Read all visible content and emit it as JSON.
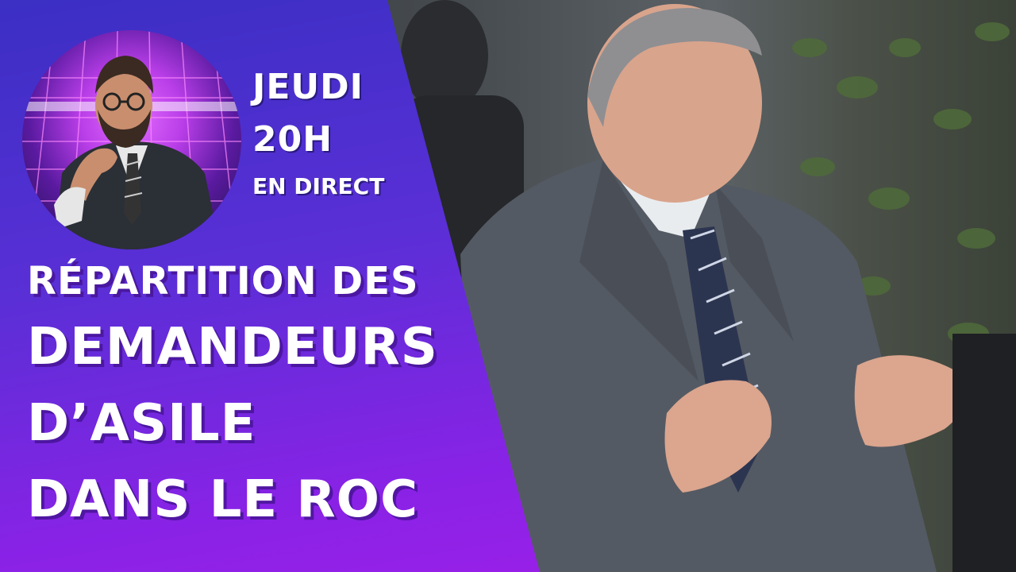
{
  "colors": {
    "panel_top": "#3b2fc4",
    "panel_bottom": "#a21fe8",
    "text": "#ffffff"
  },
  "show": {
    "day": "JEUDI",
    "time": "20H",
    "live": "EN DIRECT"
  },
  "headline": {
    "line1": "RÉPARTITION DES",
    "line2": "DEMANDEURS",
    "line3": "D’ASILE",
    "line4": "DANS LE ROC"
  }
}
